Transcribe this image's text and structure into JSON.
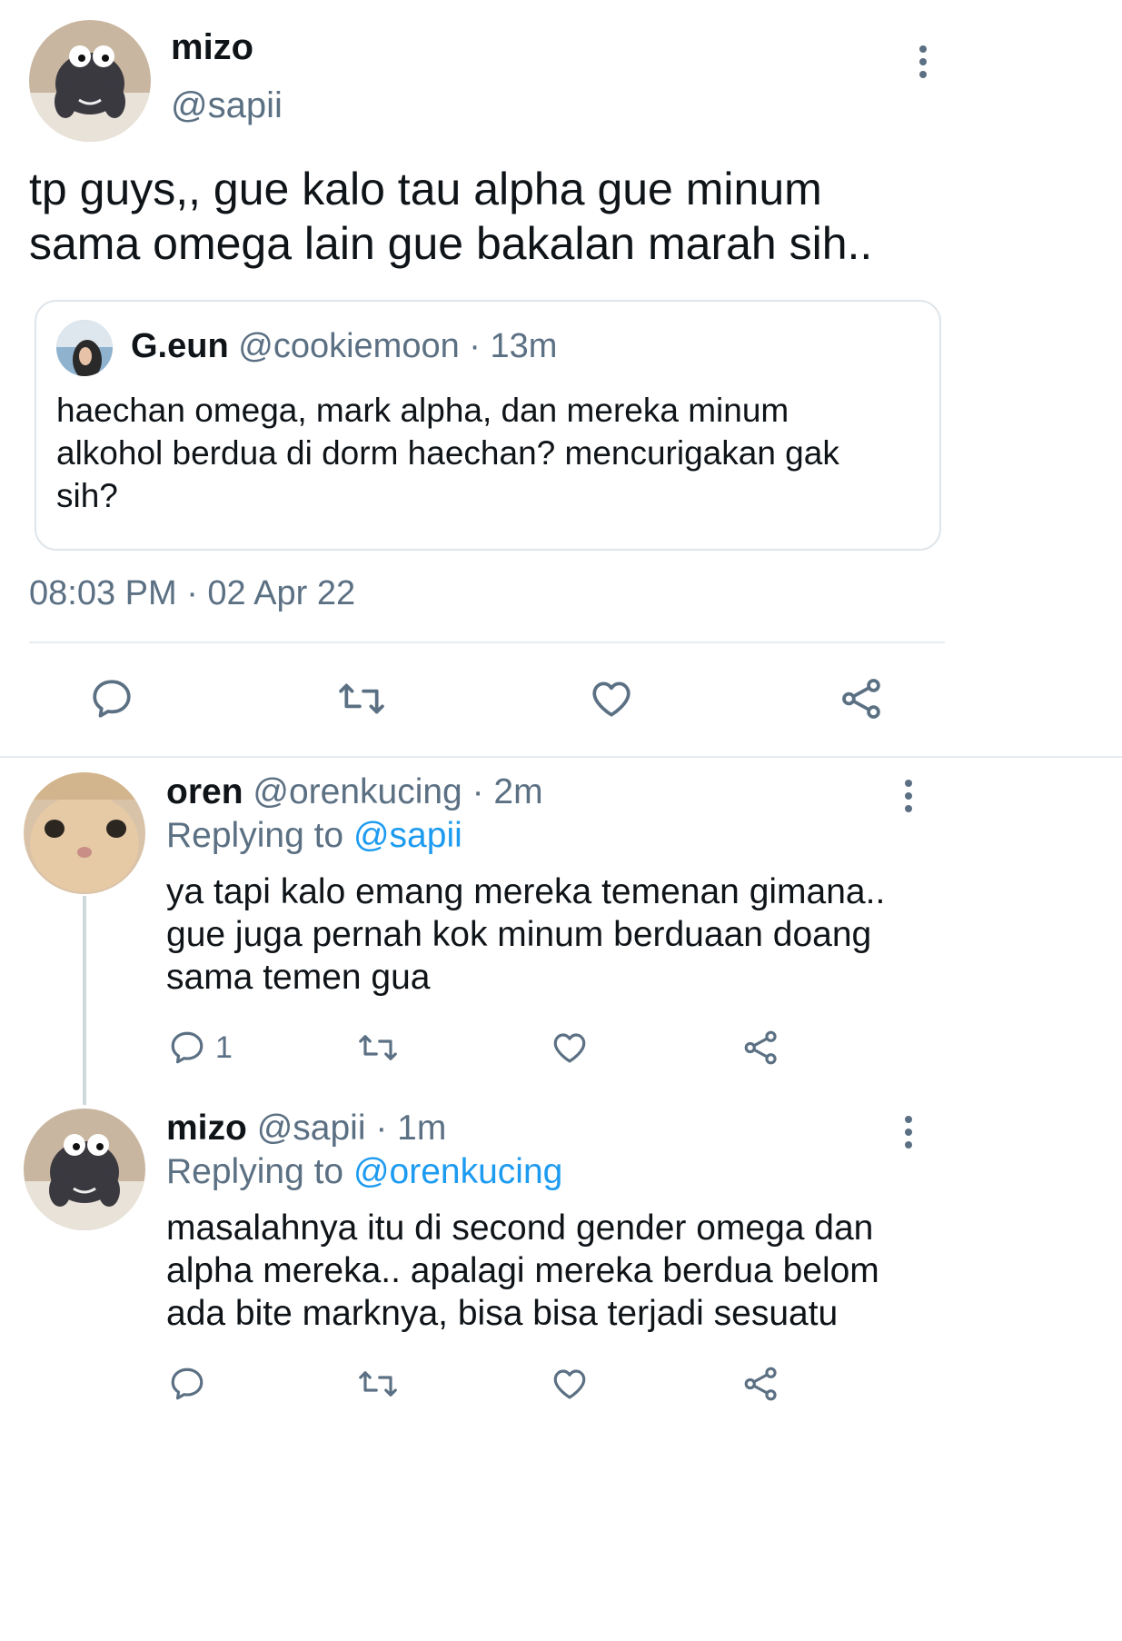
{
  "main_tweet": {
    "display_name": "mizo",
    "handle": "@sapii",
    "text_line1": "tp guys,, gue kalo tau alpha gue minum",
    "text_line2": "sama omega lain gue bakalan marah sih..",
    "quoted": {
      "display_name": "G.eun",
      "handle": "@cookiemoon",
      "time": "· 13m",
      "text_line1": "haechan omega, mark alpha, dan mereka minum",
      "text_line2": "alkohol berdua di dorm haechan? mencurigakan gak",
      "text_line3": "sih?"
    },
    "timestamp": "08:03 PM · 02 Apr 22",
    "actions": [
      "reply-icon",
      "retweet-icon",
      "like-icon",
      "share-icon"
    ]
  },
  "replies": [
    {
      "display_name": "oren",
      "handle": "@orenkucing",
      "time": "· 2m",
      "replying_prefix": "Replying to",
      "replying_to": "@sapii",
      "text_line1": "ya tapi kalo emang mereka temenan gimana..",
      "text_line2": "gue juga pernah kok minum berduaan doang",
      "text_line3": "sama temen gua",
      "reply_count": "1"
    },
    {
      "display_name": "mizo",
      "handle": "@sapii",
      "time": "· 1m",
      "replying_prefix": "Replying to",
      "replying_to": "@orenkucing",
      "text_line1": "masalahnya itu di second gender omega dan",
      "text_line2": "alpha mereka.. apalagi mereka berdua belom",
      "text_line3": "ada bite marknya, bisa bisa terjadi sesuatu",
      "reply_count": ""
    }
  ],
  "colors": {
    "text": "#0f1419",
    "secondary": "#5b7083",
    "link": "#1d9bf0",
    "divider": "#e6ecf0"
  }
}
